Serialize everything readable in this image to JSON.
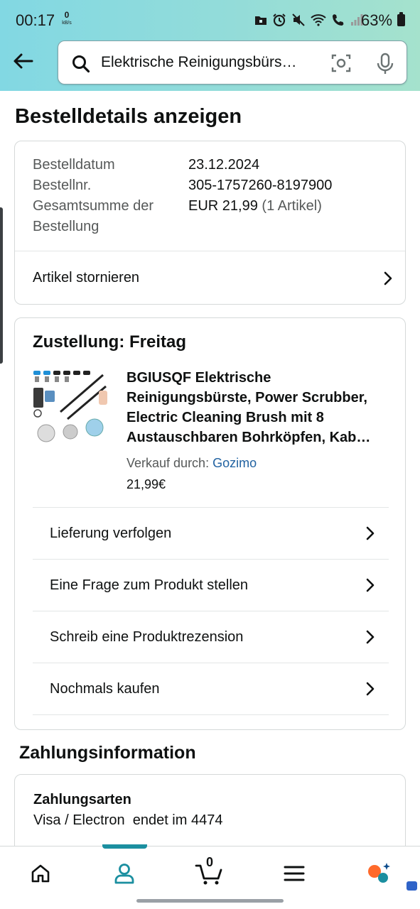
{
  "status_bar": {
    "time": "00:17",
    "net_speed_value": "0",
    "net_speed_unit": "kB/s",
    "battery": "63%"
  },
  "search": {
    "query": "Elektrische Reinigungsbürs…"
  },
  "page_title": "Bestelldetails anzeigen",
  "order_summary": {
    "date_label": "Bestelldatum",
    "date_value": "23.12.2024",
    "number_label": "Bestellnr.",
    "number_value": "305-1757260-8197900",
    "total_label": "Gesamtsumme der Bestellung",
    "total_value": "EUR 21,99",
    "total_items": "(1 Artikel)",
    "cancel_label": "Artikel stornieren"
  },
  "shipment": {
    "heading": "Zustellung: Freitag",
    "product_title": "BGIUSQF Elektrische Reinigungsbürste, Power Scrubber, Electric Cleaning Brush mit 8 Austauschbaren Bohrköpfen, Kab…",
    "seller_label": "Verkauf durch:",
    "seller_name": "Gozimo",
    "price": "21,99€",
    "actions": [
      {
        "label": "Lieferung verfolgen"
      },
      {
        "label": "Eine Frage zum Produkt stellen"
      },
      {
        "label": "Schreib eine Produktrezension"
      },
      {
        "label": "Nochmals kaufen"
      }
    ]
  },
  "payment": {
    "section_title": "Zahlungsinformation",
    "methods_heading": "Zahlungsarten",
    "method_value": "Visa / Electron  endet im 4474"
  },
  "bottom_nav": {
    "cart_count": "0",
    "active_tab": "account",
    "accent_color": "#1b8fa0"
  }
}
